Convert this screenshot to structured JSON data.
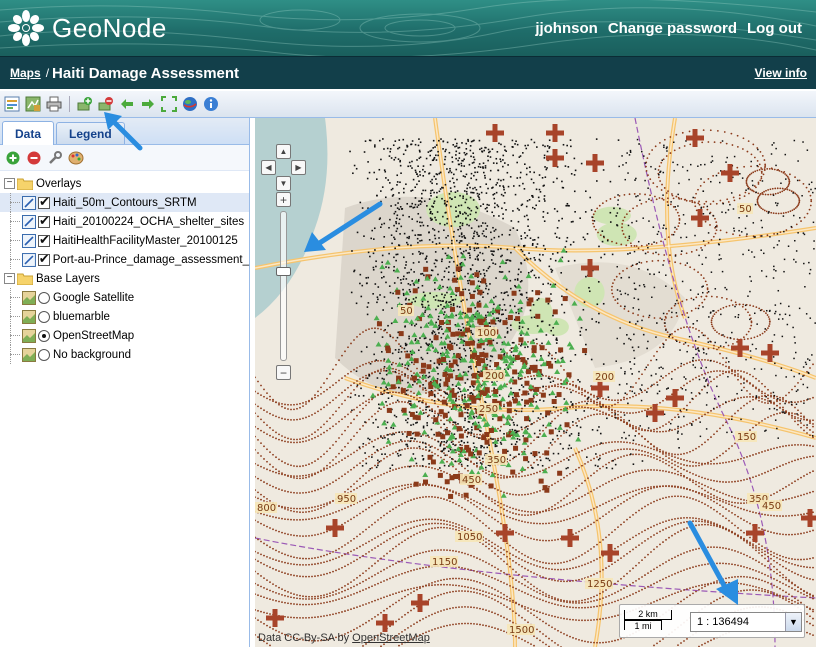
{
  "app": {
    "name": "GeoNode"
  },
  "user_nav": {
    "username": "jjohnson",
    "change_password": "Change password",
    "logout": "Log out"
  },
  "titlebar": {
    "breadcrumb_root": "Maps",
    "separator": "/",
    "title": "Haiti Damage Assessment",
    "view_info": "View info"
  },
  "toolbar": {
    "buttons": [
      "layer-properties-icon",
      "save-map-icon",
      "print-icon",
      "add-layer-icon",
      "remove-layer-icon",
      "back-arrow-icon",
      "forward-arrow-icon",
      "zoom-extent-icon",
      "globe-icon",
      "info-icon"
    ]
  },
  "panel": {
    "tabs": [
      "Data",
      "Legend"
    ],
    "active_tab": "Data",
    "tools": [
      "add-icon",
      "remove-icon",
      "wrench-icon",
      "style-icon"
    ]
  },
  "tree": {
    "overlays": {
      "label": "Overlays",
      "layers": [
        {
          "label": "Haiti_50m_Contours_SRTM",
          "checked": true,
          "selected": true
        },
        {
          "label": "Haiti_20100224_OCHA_shelter_sites",
          "checked": true
        },
        {
          "label": "HaitiHealthFacilityMaster_20100125",
          "checked": true
        },
        {
          "label": "Port-au-Prince_damage_assessment_",
          "checked": true
        }
      ]
    },
    "base_layers": {
      "label": "Base Layers",
      "layers": [
        {
          "label": "Google Satellite",
          "selected": false
        },
        {
          "label": "bluemarble",
          "selected": false
        },
        {
          "label": "OpenStreetMap",
          "selected": true
        },
        {
          "label": "No background",
          "selected": false
        }
      ]
    }
  },
  "map": {
    "scale_line": {
      "km": "2 km",
      "mi": "1 mi"
    },
    "scale_value": "1 : 136494",
    "attribution_prefix": "Data CC-By-SA by",
    "attribution_link": "OpenStreetMap",
    "colors": {
      "land": "#efeae0",
      "water": "#b5d0d0",
      "contour": "#8b3a1a",
      "shelter": "#4caf50",
      "damage": "#111111",
      "hospital_cross": "#a8442a",
      "accent_arrow": "#2a8de0"
    }
  }
}
